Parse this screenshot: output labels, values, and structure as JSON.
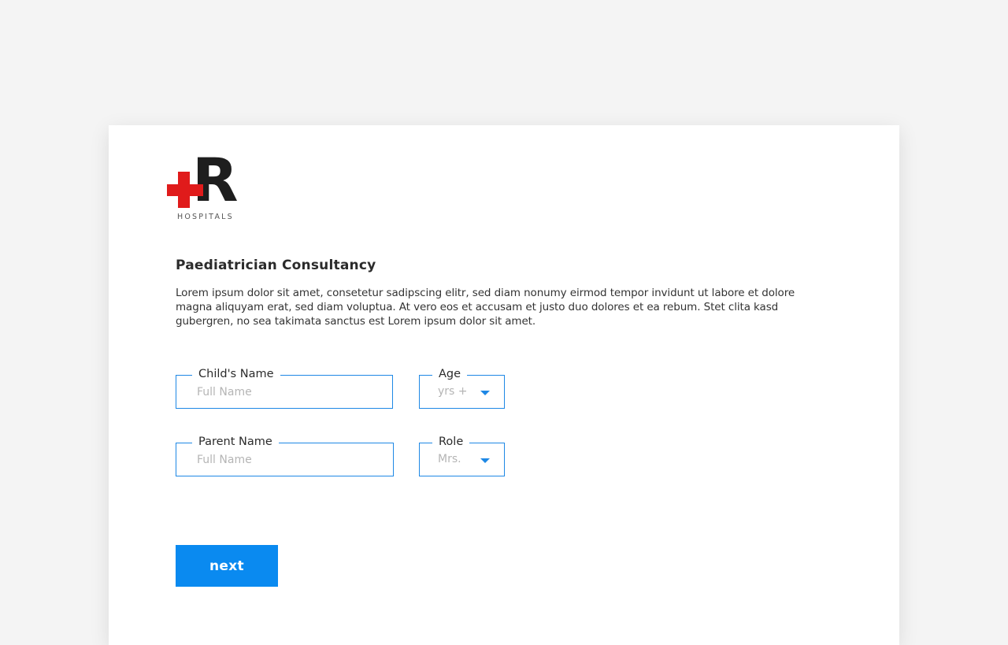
{
  "brand": {
    "letter": "R",
    "subtitle": "HOSPITALS",
    "cross_color": "#e01b1b"
  },
  "page": {
    "title": "Paediatrician Consultancy",
    "description": "Lorem ipsum dolor sit amet, consetetur sadipscing elitr, sed diam nonumy eirmod tempor invidunt ut labore et dolore magna aliquyam erat, sed diam voluptua. At vero eos et accusam et justo duo dolores et ea rebum. Stet clita kasd gubergren, no sea takimata sanctus est Lorem ipsum dolor sit amet."
  },
  "form": {
    "child_name": {
      "label": "Child's Name",
      "placeholder": "Full Name"
    },
    "age": {
      "label": "Age",
      "value": "yrs +"
    },
    "parent_name": {
      "label": "Parent Name",
      "placeholder": "Full Name"
    },
    "role": {
      "label": "Role",
      "value": "Mrs."
    }
  },
  "actions": {
    "next_label": "next",
    "accent": "#0a8af0"
  }
}
